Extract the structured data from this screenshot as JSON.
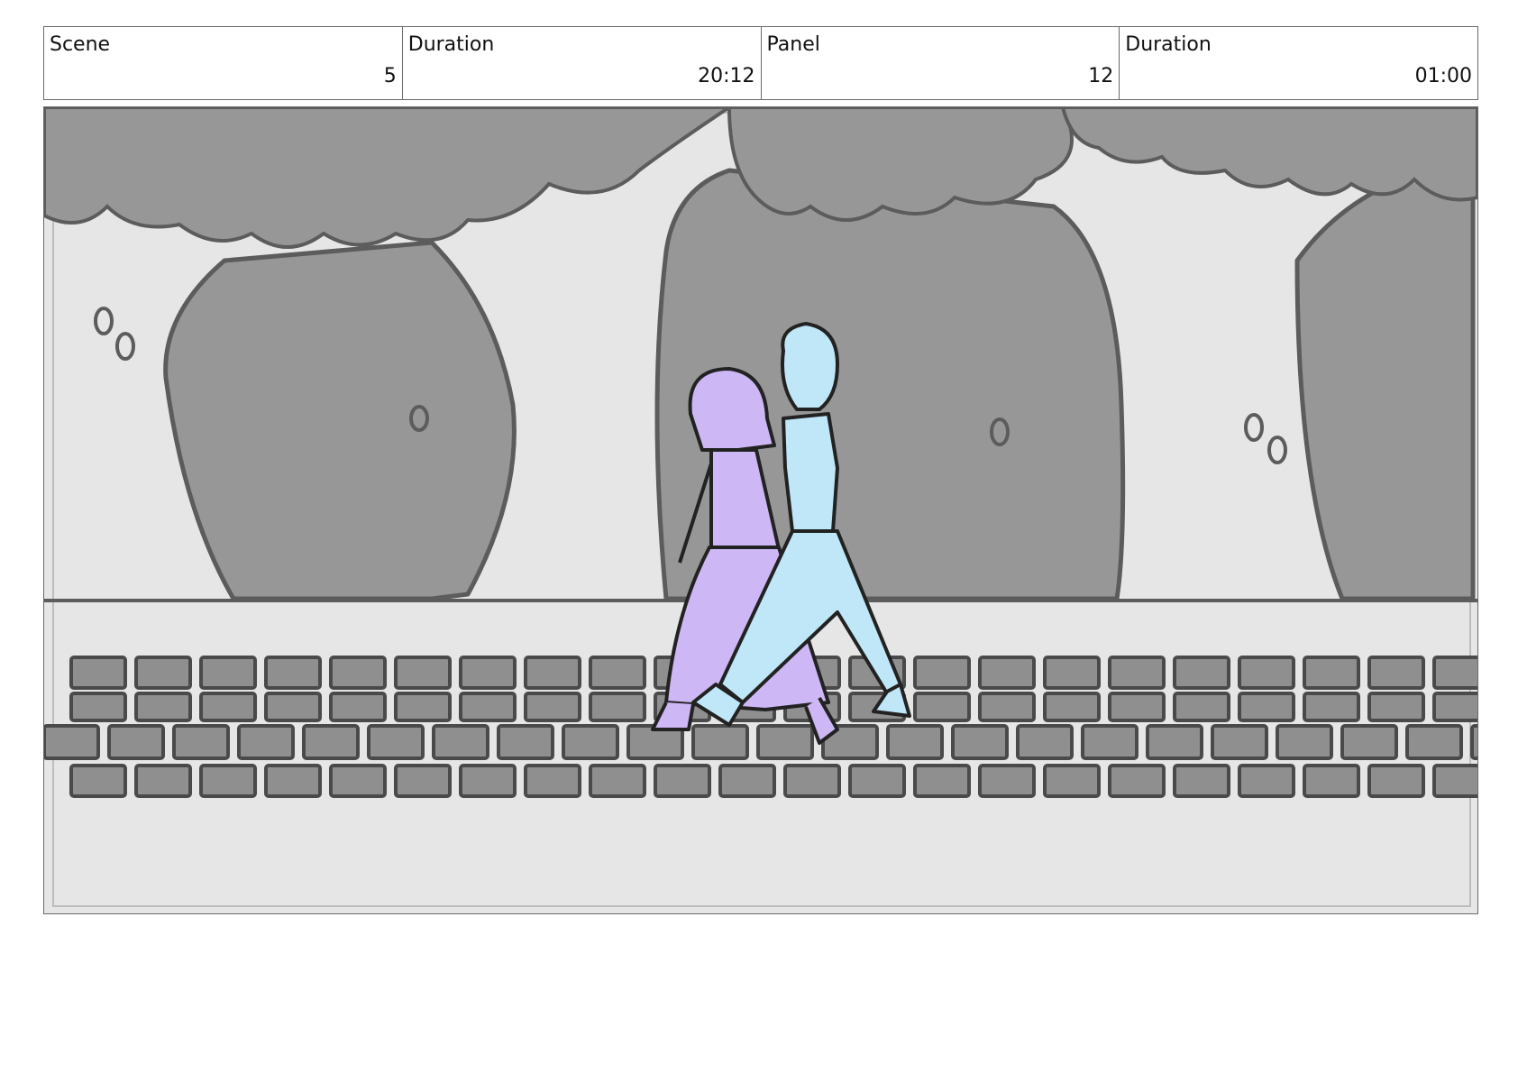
{
  "header": {
    "cells": [
      {
        "label": "Scene",
        "value": "5"
      },
      {
        "label": "Duration",
        "value": "20:12"
      },
      {
        "label": "Panel",
        "value": "12"
      },
      {
        "label": "Duration",
        "value": "01:00"
      }
    ]
  },
  "panel": {
    "colors": {
      "background": "#e6e6e6",
      "foliage": "#979797",
      "outline": "#5c5c5c",
      "paving_stone": "#8f8f8f",
      "woman_dress": "#cdb7f5",
      "man_clothes": "#bfe7f8"
    },
    "icons": [
      "tree-icon",
      "woman-walking-icon",
      "man-walking-icon",
      "paving-stones-icon"
    ]
  }
}
